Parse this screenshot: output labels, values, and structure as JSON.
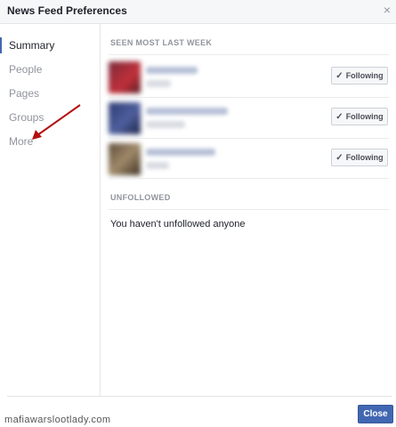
{
  "dialog": {
    "title": "News Feed Preferences",
    "close_glyph": "×"
  },
  "sidebar": {
    "items": [
      {
        "label": "Summary",
        "active": true
      },
      {
        "label": "People"
      },
      {
        "label": "Pages"
      },
      {
        "label": "Groups"
      },
      {
        "label": "More"
      }
    ]
  },
  "seen": {
    "heading": "SEEN MOST LAST WEEK",
    "rows": [
      {
        "button_label": "Following",
        "button_icon": "check-icon"
      },
      {
        "button_label": "Following",
        "button_icon": "check-icon"
      },
      {
        "button_label": "Following",
        "button_icon": "check-icon"
      }
    ]
  },
  "unfollowed": {
    "heading": "UNFOLLOWED",
    "empty_text": "You haven't unfollowed anyone"
  },
  "footer": {
    "close_label": "Close"
  },
  "watermark": "mafiawarslootlady.com",
  "colors": {
    "accent": "#4267b2",
    "annotation_arrow": "#b20f0f"
  }
}
